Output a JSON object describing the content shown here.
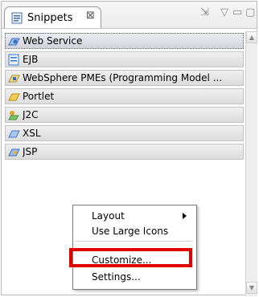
{
  "view": {
    "title": "Snippets",
    "close_glyph": "⊠",
    "toolbar_icons": [
      "customize-palette-icon",
      "view-menu-icon",
      "minimize-icon",
      "maximize-icon"
    ],
    "toolbar_glyphs": [
      "⇲",
      "▽",
      "▭",
      "▢"
    ]
  },
  "drawers": [
    {
      "label": "Web Service",
      "icon": "web-service-icon",
      "color": "#3a6fc4"
    },
    {
      "label": "EJB",
      "icon": "ejb-icon",
      "color": "#3b78c8"
    },
    {
      "label": "WebSphere PMEs (Programming Model ...",
      "icon": "websphere-pme-icon",
      "color": "#c4a23a"
    },
    {
      "label": "Portlet",
      "icon": "portlet-icon",
      "color": "#d8a520"
    },
    {
      "label": "J2C",
      "icon": "j2c-icon",
      "color": "#3a9a3a"
    },
    {
      "label": "XSL",
      "icon": "xsl-icon",
      "color": "#4878c8"
    },
    {
      "label": "JSP",
      "icon": "jsp-icon",
      "color": "#3a6fc4"
    }
  ],
  "context_menu": {
    "items": [
      {
        "label": "Layout",
        "has_submenu": true
      },
      {
        "label": "Use Large Icons",
        "has_submenu": false
      },
      {
        "label": "Customize...",
        "has_submenu": false
      },
      {
        "label": "Settings...",
        "has_submenu": false
      }
    ],
    "highlighted_item": "Customize...",
    "highlight_color": "#e00000"
  },
  "scrollbar": {
    "up_glyph": "▲",
    "down_glyph": "▼"
  }
}
